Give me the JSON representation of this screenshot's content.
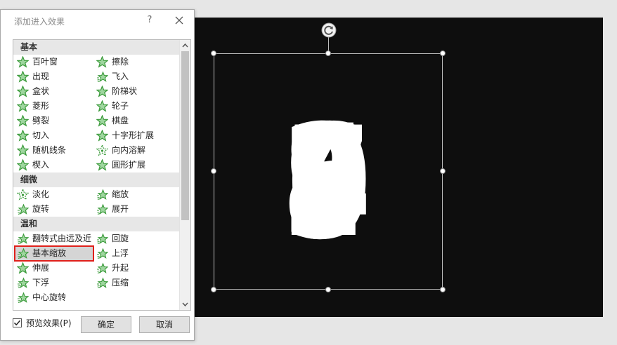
{
  "dialog": {
    "title": "添加进入效果",
    "help_label": "?",
    "sections": [
      {
        "name": "基本",
        "rows": [
          [
            {
              "label": "百叶窗",
              "icon": "star-full-icon"
            },
            {
              "label": "擦除",
              "icon": "star-full-icon"
            }
          ],
          [
            {
              "label": "出现",
              "icon": "star-full-icon"
            },
            {
              "label": "飞入",
              "icon": "star-fly-icon"
            }
          ],
          [
            {
              "label": "盒状",
              "icon": "star-full-icon"
            },
            {
              "label": "阶梯状",
              "icon": "star-full-icon"
            }
          ],
          [
            {
              "label": "菱形",
              "icon": "star-full-icon"
            },
            {
              "label": "轮子",
              "icon": "star-full-icon"
            }
          ],
          [
            {
              "label": "劈裂",
              "icon": "star-full-icon"
            },
            {
              "label": "棋盘",
              "icon": "star-full-icon"
            }
          ],
          [
            {
              "label": "切入",
              "icon": "star-full-icon"
            },
            {
              "label": "十字形扩展",
              "icon": "star-full-icon"
            }
          ],
          [
            {
              "label": "随机线条",
              "icon": "star-full-icon"
            },
            {
              "label": "向内溶解",
              "icon": "star-dissolve-icon"
            }
          ],
          [
            {
              "label": "楔入",
              "icon": "star-full-icon"
            },
            {
              "label": "圆形扩展",
              "icon": "star-full-icon"
            }
          ]
        ]
      },
      {
        "name": "细微",
        "rows": [
          [
            {
              "label": "淡化",
              "icon": "star-dissolve-icon"
            },
            {
              "label": "缩放",
              "icon": "star-fly-icon"
            }
          ],
          [
            {
              "label": "旋转",
              "icon": "star-fly-icon"
            },
            {
              "label": "展开",
              "icon": "star-fly-icon"
            }
          ]
        ]
      },
      {
        "name": "温和",
        "rows": [
          [
            {
              "label": "翻转式由远及近",
              "icon": "star-fly-icon"
            },
            {
              "label": "回旋",
              "icon": "star-fly-icon"
            }
          ],
          [
            {
              "label": "基本缩放",
              "icon": "star-fly-icon",
              "selected": true
            },
            {
              "label": "上浮",
              "icon": "star-fly-icon"
            }
          ],
          [
            {
              "label": "伸展",
              "icon": "star-full-icon"
            },
            {
              "label": "升起",
              "icon": "star-fly-icon"
            }
          ],
          [
            {
              "label": "下浮",
              "icon": "star-fly-icon"
            },
            {
              "label": "压缩",
              "icon": "star-fly-icon"
            }
          ],
          [
            {
              "label": "中心旋转",
              "icon": "star-fly-icon"
            },
            null
          ]
        ]
      }
    ],
    "preview_label": "预览效果(P)",
    "preview_checked": true,
    "ok_label": "确定",
    "cancel_label": "取消"
  },
  "colors": {
    "star_green": "#3a9a3a",
    "star_light": "#9fd69f",
    "slide_bg": "#0e0e0e",
    "selection_outline": "#e0201b"
  },
  "slide": {
    "overlapping_digits": [
      "2",
      "3",
      "4",
      "5",
      "6",
      "7",
      "8",
      "9",
      "0"
    ]
  }
}
